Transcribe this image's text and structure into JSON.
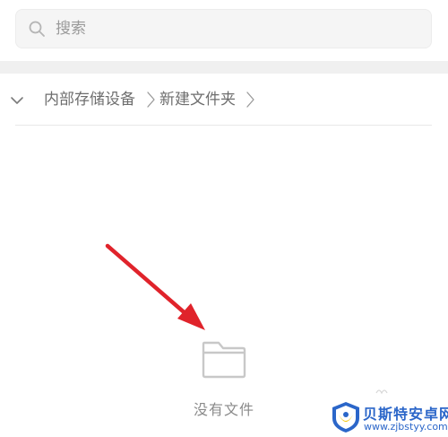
{
  "search": {
    "placeholder": "搜索",
    "value": ""
  },
  "breadcrumb": {
    "items": [
      {
        "label": "内部存储设备"
      },
      {
        "label": "新建文件夹"
      }
    ]
  },
  "empty_state": {
    "message": "没有文件"
  },
  "watermark": {
    "title": "贝斯特安卓网",
    "url": "www.zjbstyy.com"
  },
  "colors": {
    "arrow": "#e0232b",
    "folder_icon": "#c8c8c8",
    "watermark_blue": "#2b66c9",
    "watermark_yellow": "#f5c400"
  }
}
